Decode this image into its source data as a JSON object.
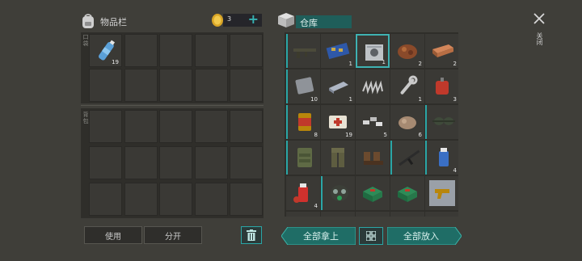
{
  "inventory": {
    "title": "物品栏",
    "coins": "3",
    "add_symbol": "+",
    "pocket_label": "口袋",
    "backpack_label": "背包",
    "first_slot_count": "19"
  },
  "storage": {
    "title": "仓库",
    "counts": [
      "",
      "1",
      "1",
      "2",
      "2",
      "10",
      "1",
      "",
      "1",
      "3",
      "8",
      "19",
      "5",
      "6",
      "",
      "",
      "",
      "",
      "",
      "4",
      "4",
      "",
      "",
      "",
      ""
    ],
    "icons": [
      "rifle",
      "circuit",
      "safe",
      "ore",
      "brick",
      "metal-plate",
      "ingot",
      "spring",
      "wrench",
      "gas-can",
      "food-can",
      "medkit",
      "bolts",
      "rock",
      "goggles",
      "vest",
      "pants",
      "boots",
      "assault-rifle",
      "spray-can",
      "fire-ext",
      "gas-mask",
      "supply-box",
      "supply-box",
      "pistol-blueprint"
    ]
  },
  "buttons": {
    "use": "使用",
    "split": "分开",
    "take_all": "全部拿上",
    "put_all": "全部放入",
    "close": "关闭"
  },
  "colors": {
    "accent": "#1f6d66",
    "highlight": "#2aa6a6",
    "bg": "#3f3e39"
  }
}
